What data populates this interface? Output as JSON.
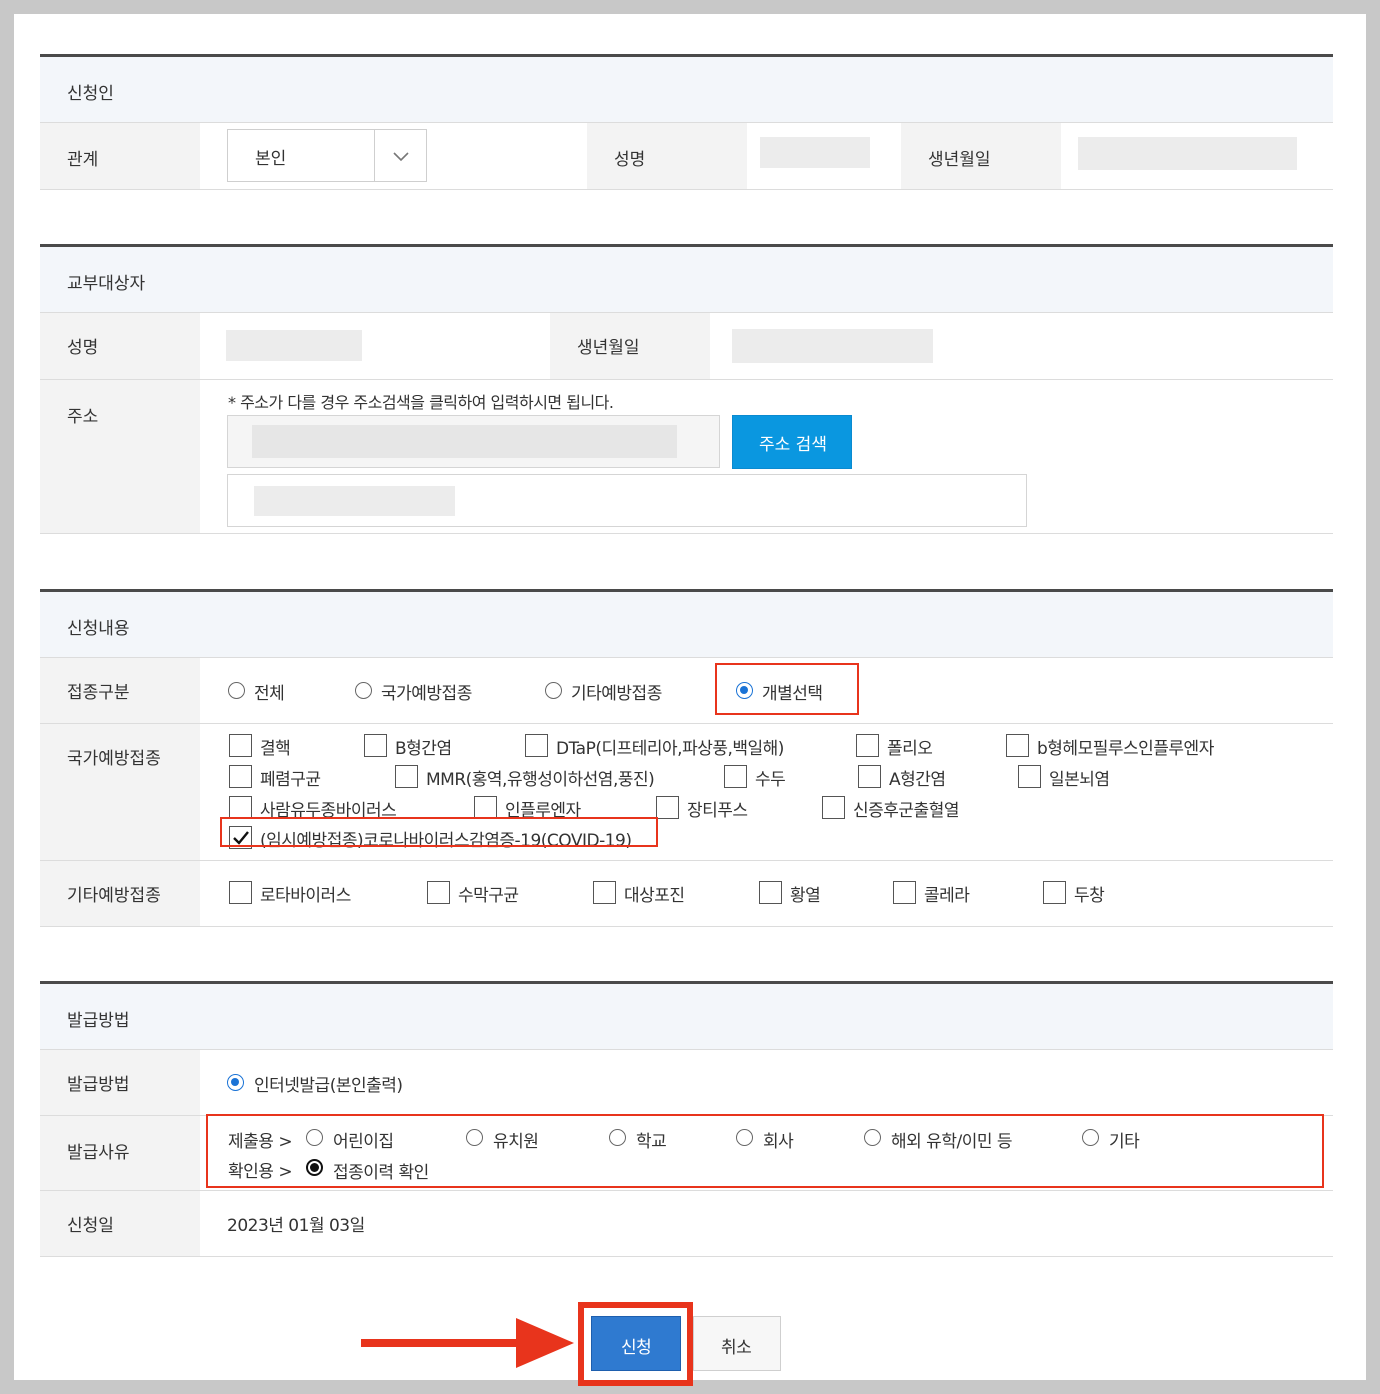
{
  "applicant": {
    "section_title": "신청인",
    "relation_label": "관계",
    "relation_value": "본인",
    "name_label": "성명",
    "birth_label": "생년월일"
  },
  "target": {
    "section_title": "교부대상자",
    "name_label": "성명",
    "birth_label": "생년월일",
    "address_label": "주소",
    "address_note": "* 주소가 다를 경우 주소검색을 클릭하여 입력하시면 됩니다.",
    "address_search_button": "주소 검색"
  },
  "content": {
    "section_title": "신청내용",
    "type_label": "접종구분",
    "type_options": [
      "전체",
      "국가예방접종",
      "기타예방접종",
      "개별선택"
    ],
    "type_selected": "개별선택",
    "national_label": "국가예방접종",
    "national_items": [
      {
        "label": "결핵",
        "checked": false
      },
      {
        "label": "B형간염",
        "checked": false
      },
      {
        "label": "DTaP(디프테리아,파상풍,백일해)",
        "checked": false
      },
      {
        "label": "폴리오",
        "checked": false
      },
      {
        "label": "b형헤모필루스인플루엔자",
        "checked": false
      },
      {
        "label": "폐렴구균",
        "checked": false
      },
      {
        "label": "MMR(홍역,유행성이하선염,풍진)",
        "checked": false
      },
      {
        "label": "수두",
        "checked": false
      },
      {
        "label": "A형간염",
        "checked": false
      },
      {
        "label": "일본뇌염",
        "checked": false
      },
      {
        "label": "사람유두종바이러스",
        "checked": false
      },
      {
        "label": "인플루엔자",
        "checked": false
      },
      {
        "label": "장티푸스",
        "checked": false
      },
      {
        "label": "신증후군출혈열",
        "checked": false
      },
      {
        "label": "(임시예방접종)코로나바이러스감염증-19(COVID-19)",
        "checked": true
      }
    ],
    "other_label": "기타예방접종",
    "other_items": [
      {
        "label": "로타바이러스",
        "checked": false
      },
      {
        "label": "수막구균",
        "checked": false
      },
      {
        "label": "대상포진",
        "checked": false
      },
      {
        "label": "황열",
        "checked": false
      },
      {
        "label": "콜레라",
        "checked": false
      },
      {
        "label": "두창",
        "checked": false
      }
    ]
  },
  "issue": {
    "section_title": "발급방법",
    "method_label": "발급방법",
    "method_option": "인터넷발급(본인출력)",
    "reason_label": "발급사유",
    "submit_prefix": "제출용 >",
    "submit_options": [
      "어린이집",
      "유치원",
      "학교",
      "회사",
      "해외 유학/이민 등",
      "기타"
    ],
    "confirm_prefix": "확인용 >",
    "confirm_option": "접종이력 확인",
    "date_label": "신청일",
    "date_value": "2023년 01월 03일"
  },
  "actions": {
    "apply_button": "신청",
    "cancel_button": "취소"
  },
  "colors": {
    "accent_blue": "#0a97e0",
    "apply_blue": "#2f7ad0",
    "highlight_red": "#e8341c"
  }
}
